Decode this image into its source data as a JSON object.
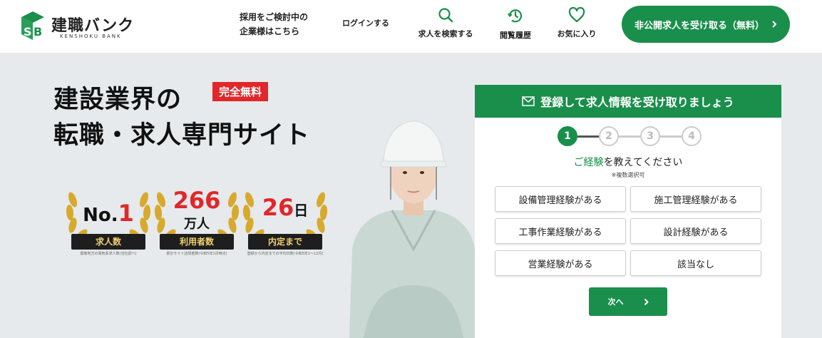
{
  "brand": {
    "name": "建職バンク",
    "sub": "KENSHOKU BANK",
    "green": "#1a8e4b",
    "red": "#e2262a"
  },
  "header": {
    "corp_link": [
      "採用をご検討中の",
      "企業様はこちら"
    ],
    "login": "ログインする",
    "nav": [
      {
        "label": "求人を検索する",
        "icon": "search-icon"
      },
      {
        "label": "閲覧履歴",
        "icon": "history-clock-icon"
      },
      {
        "label": "お気に入り",
        "icon": "heart-icon"
      }
    ],
    "cta": "非公開求人を受け取る（無料）"
  },
  "hero": {
    "title_lines": [
      "建設業界の",
      "転職・求人専門サイト"
    ],
    "badge": "完全無料",
    "awards": [
      {
        "main": "No.",
        "num": "1",
        "unit": "",
        "label": "求人数",
        "note": "関東地方の電気系求人数(当社調べ)"
      },
      {
        "main": "",
        "num": "266",
        "unit": "万人",
        "label": "利用者数",
        "note": "累計サイト訪問者数(令和5年1月時点)"
      },
      {
        "main": "",
        "num": "26",
        "unit": "日",
        "label": "内定まで",
        "note": "登録から内定までの平均日数(令和5年1〜12月)"
      }
    ]
  },
  "form": {
    "header": "登録して求人情報を受け取りましょう",
    "steps": [
      "1",
      "2",
      "3",
      "4"
    ],
    "question_hl": "ご経験",
    "question_rest": "を教えてください",
    "note": "※複数選択可",
    "options": [
      "設備管理経験がある",
      "施工管理経験がある",
      "工事作業経験がある",
      "設計経験がある",
      "営業経験がある",
      "該当なし"
    ],
    "next": "次へ"
  }
}
